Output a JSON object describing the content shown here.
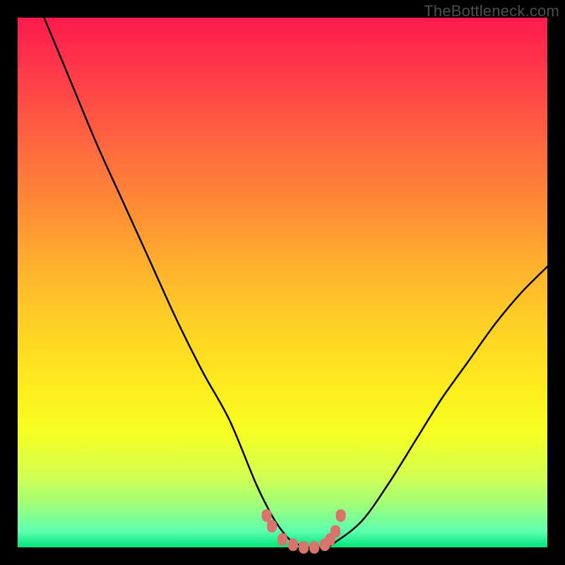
{
  "watermark": "TheBottleneck.com",
  "colors": {
    "background": "#000000",
    "curve": "#000000",
    "marker": "#d9746c",
    "gradient_top": "#ff1a4d",
    "gradient_bottom": "#00e47a"
  },
  "chart_data": {
    "type": "line",
    "title": "",
    "xlabel": "",
    "ylabel": "",
    "xlim": [
      0,
      100
    ],
    "ylim": [
      0,
      100
    ],
    "series": [
      {
        "name": "bottleneck-curve",
        "x": [
          5,
          10,
          15,
          20,
          25,
          30,
          35,
          40,
          45,
          48,
          50,
          52,
          55,
          58,
          60,
          65,
          70,
          75,
          80,
          85,
          90,
          95,
          100
        ],
        "y": [
          100,
          88,
          76,
          65,
          54,
          43,
          33,
          24,
          12,
          6,
          3,
          1,
          0,
          0,
          1,
          5,
          12,
          20,
          28,
          35,
          42,
          48,
          53
        ]
      }
    ],
    "markers": {
      "name": "highlight-band",
      "x": [
        47,
        48,
        50,
        52,
        54,
        56,
        58,
        59,
        60,
        61
      ],
      "y": [
        6,
        4,
        1.5,
        0.5,
        0,
        0,
        0.5,
        1.5,
        3,
        6
      ]
    }
  }
}
